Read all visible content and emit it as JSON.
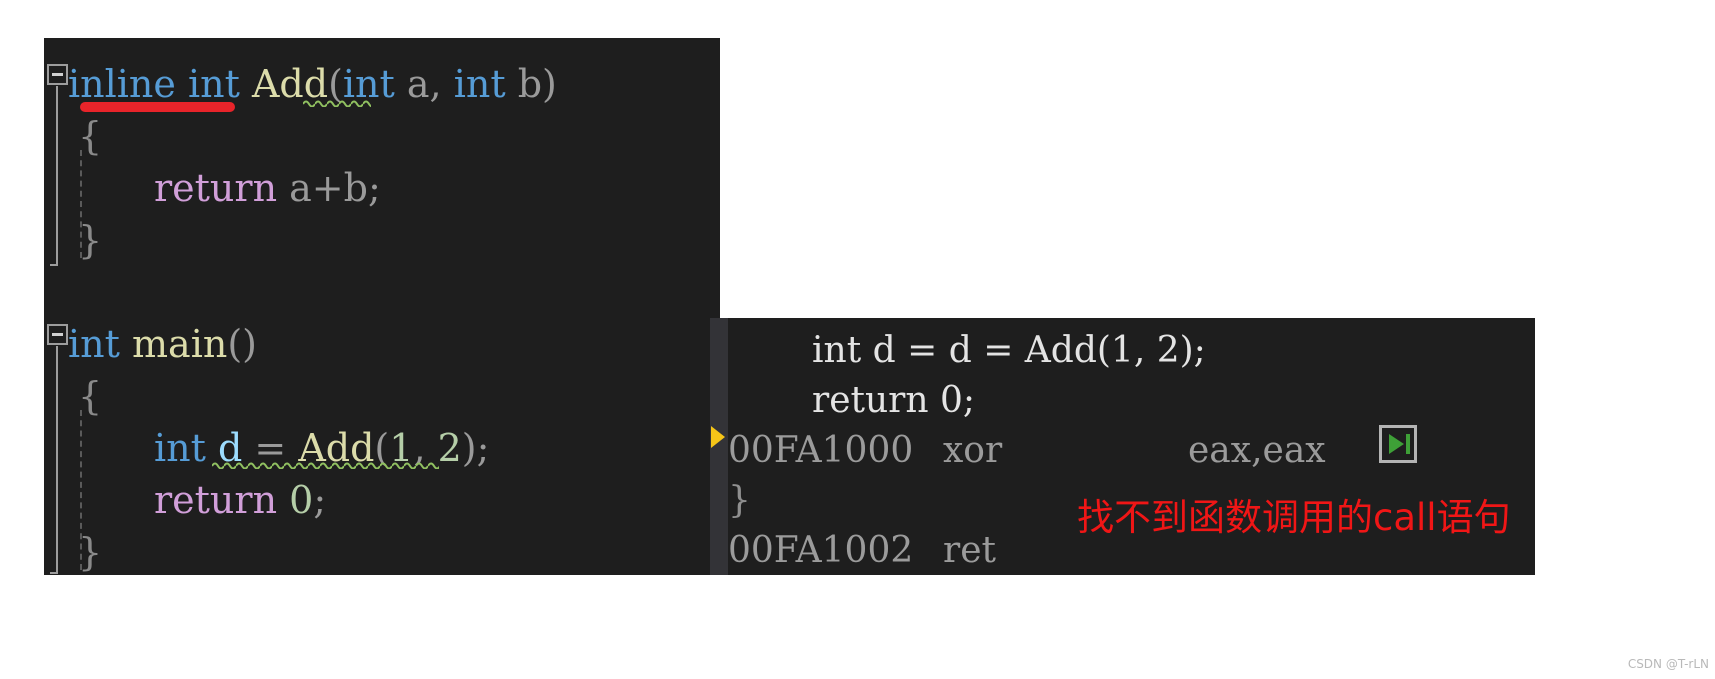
{
  "editor": {
    "background_color": "#1e1e1e",
    "lines": [
      {
        "id": "fn-inline-signature",
        "tokens": [
          {
            "text": "inline",
            "role": "keyword",
            "color": "#569cd6"
          },
          {
            "text": " int ",
            "role": "keyword",
            "color": "#569cd6"
          },
          {
            "text": "Add",
            "role": "function-name",
            "color": "#dcdcaa"
          },
          {
            "text": "(",
            "role": "punctuation",
            "color": "#9a9a9a"
          },
          {
            "text": "int",
            "role": "keyword",
            "color": "#569cd6"
          },
          {
            "text": " a, ",
            "role": "identifier",
            "color": "#9a9a9a"
          },
          {
            "text": "int",
            "role": "keyword",
            "color": "#569cd6"
          },
          {
            "text": " b)",
            "role": "identifier",
            "color": "#9a9a9a"
          }
        ],
        "plain": "inline int Add(int a, int b)"
      },
      {
        "id": "brace-open-add",
        "plain": "{"
      },
      {
        "id": "return-a-plus-b",
        "tokens": [
          {
            "text": "return",
            "role": "keyword",
            "color": "#d19fd9"
          },
          {
            "text": " a+b;",
            "role": "expression",
            "color": "#9a9a9a"
          }
        ],
        "plain": "    return a+b;"
      },
      {
        "id": "brace-close-add",
        "plain": "}"
      },
      {
        "id": "fn-main-signature",
        "tokens": [
          {
            "text": "int",
            "role": "keyword",
            "color": "#569cd6"
          },
          {
            "text": " ",
            "role": "space",
            "color": "#9a9a9a"
          },
          {
            "text": "main",
            "role": "function-name",
            "color": "#dcdcaa"
          },
          {
            "text": "()",
            "role": "punctuation",
            "color": "#9a9a9a"
          }
        ],
        "plain": "int main()"
      },
      {
        "id": "brace-open-main",
        "plain": "{"
      },
      {
        "id": "call-add-statement",
        "tokens": [
          {
            "text": "int",
            "role": "keyword",
            "color": "#569cd6"
          },
          {
            "text": " ",
            "role": "space",
            "color": "#9a9a9a"
          },
          {
            "text": "d",
            "role": "identifier",
            "color": "#9cdcfe"
          },
          {
            "text": " = ",
            "role": "operator",
            "color": "#9a9a9a"
          },
          {
            "text": "Add",
            "role": "function-name",
            "color": "#dcdcaa"
          },
          {
            "text": "(",
            "role": "punctuation",
            "color": "#9a9a9a"
          },
          {
            "text": "1",
            "role": "number",
            "color": "#b5cea8"
          },
          {
            "text": ", ",
            "role": "punctuation",
            "color": "#9a9a9a"
          },
          {
            "text": "2",
            "role": "number",
            "color": "#b5cea8"
          },
          {
            "text": ");",
            "role": "punctuation",
            "color": "#9a9a9a"
          }
        ],
        "plain": "    int d = Add(1, 2);"
      },
      {
        "id": "return-zero-main",
        "tokens": [
          {
            "text": "return",
            "role": "keyword",
            "color": "#d19fd9"
          },
          {
            "text": " ",
            "role": "space",
            "color": "#9a9a9a"
          },
          {
            "text": "0",
            "role": "number",
            "color": "#b5cea8"
          },
          {
            "text": ";",
            "role": "punctuation",
            "color": "#9a9a9a"
          }
        ],
        "plain": "    return 0;"
      },
      {
        "id": "brace-close-main",
        "plain": "}"
      }
    ],
    "text": {
      "l1_inline": "inline",
      "l1_int_sp": " int ",
      "l1_add": "Add",
      "l1_paren_open": "(",
      "l1_int_a_kw": "int",
      "l1_a": " a, ",
      "l1_int_b_kw": "int",
      "l1_b": " b)",
      "l2_brace": "{",
      "l3_return": "return",
      "l3_expr": " a+b;",
      "l4_brace": "}",
      "l5_int": "int",
      "l5_space": " ",
      "l5_main": "main",
      "l5_parens": "()",
      "l6_brace": "{",
      "l7_int": "int",
      "l7_space": " ",
      "l7_d": "d",
      "l7_eq": " = ",
      "l7_add": "Add",
      "l7_paren_open": "(",
      "l7_one": "1",
      "l7_comma": ", ",
      "l7_two": "2",
      "l7_close": ");",
      "l8_return": "return",
      "l8_space": " ",
      "l8_zero": "0",
      "l8_semi": ";",
      "l9_brace": "}"
    },
    "markers": {
      "red_underline_label": "inline-keyword-red-underline",
      "squiggle_add_label": "add-identifier-green-squiggle",
      "squiggle_call_label": "add-call-green-squiggle",
      "red_color": "#e8242a",
      "squiggle_color": "#90c060"
    },
    "outlining": {
      "collapse_glyph": "-",
      "boxes": [
        "collapse-add-function",
        "collapse-main-function"
      ]
    }
  },
  "disassembly": {
    "background_color": "#1e1e1e",
    "gutter_color": "#333337",
    "lines": [
      {
        "id": "src-int-d",
        "type": "source",
        "text": "    int d = d = Add(1, 2);"
      },
      {
        "id": "src-return-0",
        "type": "source",
        "text": "    return 0;"
      },
      {
        "id": "asm-xor",
        "type": "instruction",
        "address": "00FA1000",
        "mnemonic": "xor",
        "operands": "eax,eax",
        "current": true
      },
      {
        "id": "src-brace-close",
        "type": "source",
        "text": "}"
      },
      {
        "id": "asm-ret",
        "type": "instruction",
        "address": "00FA1002",
        "mnemonic": "ret",
        "operands": "",
        "current": false
      }
    ],
    "text": {
      "line1": "int d = d = Add(1, 2);",
      "line2": "return 0;",
      "addr1": "00FA1000",
      "mnem1": "xor",
      "ops1": "eax,eax",
      "brace": "}",
      "addr2": "00FA1002",
      "mnem2": "ret"
    },
    "exec_arrow": {
      "label": "current-instruction-pointer",
      "color": "#f5c518"
    }
  },
  "run_to_cursor_button": {
    "label": "Run to cursor",
    "icon": "play-to-cursor-icon",
    "triangle_color": "#3ea037",
    "border_color": "#b4b4b4"
  },
  "annotation": {
    "text": "找不到函数调用的call语句",
    "color": "#f01616"
  },
  "watermark": {
    "text": "CSDN @T-rLN",
    "color": "#b9b9b9"
  }
}
